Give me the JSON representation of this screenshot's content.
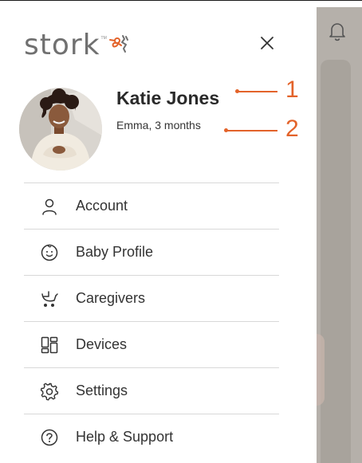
{
  "brand": {
    "logo_text": "stork",
    "logo_tm": "TM"
  },
  "profile": {
    "name": "Katie Jones",
    "child": "Emma, 3 months"
  },
  "annotations": [
    {
      "number": "1"
    },
    {
      "number": "2"
    }
  ],
  "menu": {
    "items": [
      {
        "label": "Account",
        "icon": "person-icon"
      },
      {
        "label": "Baby Profile",
        "icon": "baby-face-icon"
      },
      {
        "label": "Caregivers",
        "icon": "stroller-icon"
      },
      {
        "label": "Devices",
        "icon": "devices-grid-icon"
      },
      {
        "label": "Settings",
        "icon": "gear-icon"
      },
      {
        "label": "Help & Support",
        "icon": "help-icon"
      }
    ]
  },
  "colors": {
    "accent": "#e3632a",
    "text": "#333333",
    "divider": "#d8d8d8",
    "logo": "#707070"
  }
}
